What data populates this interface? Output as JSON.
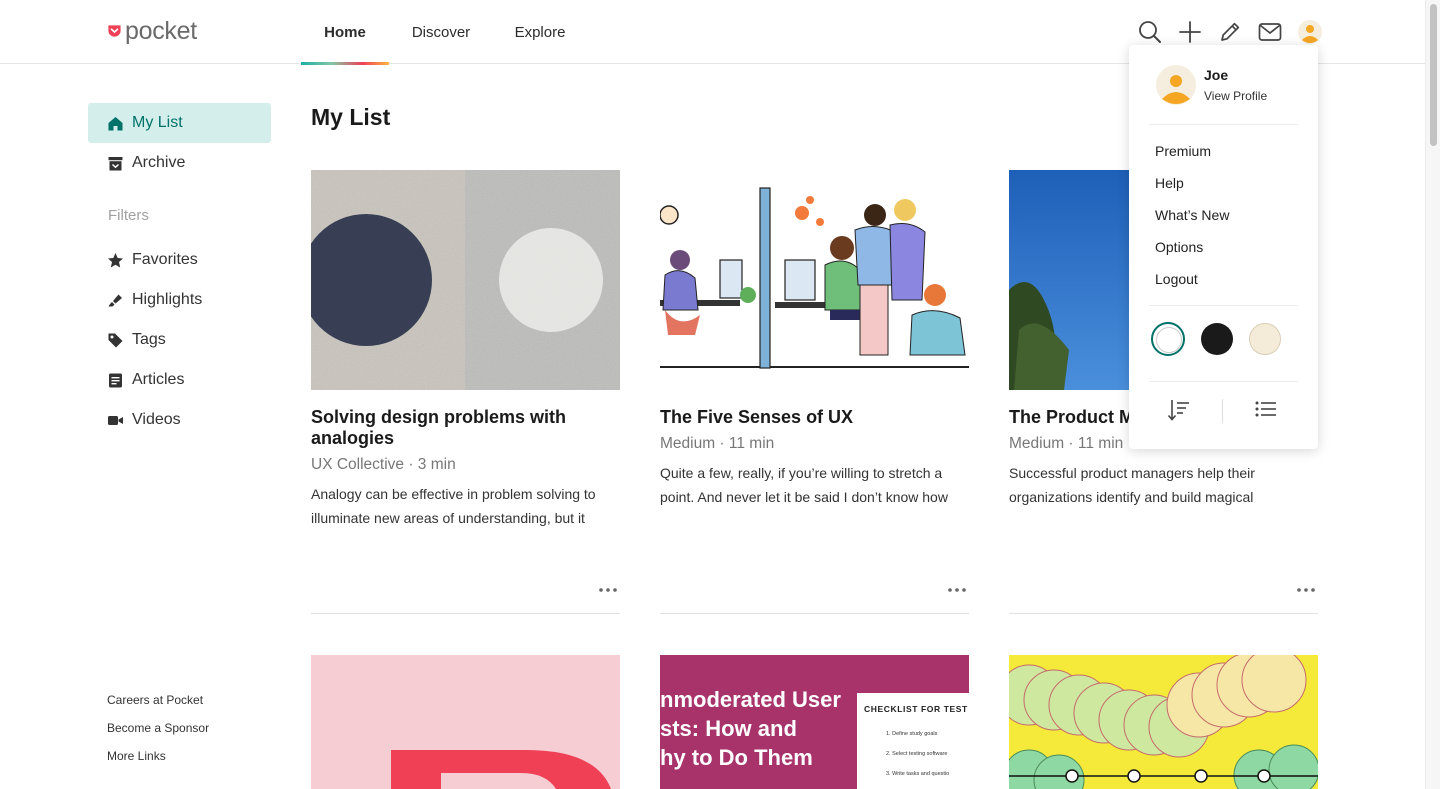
{
  "app": {
    "logo_text": "pocket",
    "brand_color": "#ef4056",
    "accent_color": "#00726a"
  },
  "nav": {
    "tabs": [
      {
        "label": "Home"
      },
      {
        "label": "Discover"
      },
      {
        "label": "Explore"
      }
    ]
  },
  "header_icons": [
    "search-icon",
    "add-icon",
    "pencil-icon",
    "mail-icon",
    "avatar-icon"
  ],
  "sidebar": {
    "items": [
      {
        "label": "My List",
        "icon": "home-icon"
      },
      {
        "label": "Archive",
        "icon": "archive-icon"
      }
    ],
    "filters_label": "Filters",
    "filters": [
      {
        "label": "Favorites",
        "icon": "star-icon"
      },
      {
        "label": "Highlights",
        "icon": "highlighter-icon"
      },
      {
        "label": "Tags",
        "icon": "tag-icon"
      },
      {
        "label": "Articles",
        "icon": "article-icon"
      },
      {
        "label": "Videos",
        "icon": "video-icon"
      }
    ],
    "footer_links": [
      "Careers at Pocket",
      "Become a Sponsor",
      "More Links"
    ]
  },
  "main": {
    "title": "My List",
    "cards": [
      {
        "title": "Solving design problems with analogies",
        "meta": "UX Collective · 3 min",
        "excerpt": "Analogy can be effective in problem solving to illuminate new areas of understanding, but it"
      },
      {
        "title": "The Five Senses of UX",
        "meta": "Medium · 11 min",
        "excerpt": "Quite a few, really, if you’re willing to stretch a point. And never let it be said I don’t know how"
      },
      {
        "title": "The Product M User Science",
        "meta": "Medium · 11 min",
        "excerpt": "Successful product managers help their organizations identify and build magical"
      }
    ],
    "second_row": {
      "card2_lines": [
        "nmoderated User",
        "sts: How and",
        "hy to Do Them"
      ],
      "card2_checklist_title": "CHECKLIST FOR TEST",
      "card2_checklist_items": [
        "1. Define study goals",
        "2. Select testing software",
        "3. Write tasks and questio"
      ]
    }
  },
  "profile_menu": {
    "name": "Joe",
    "view_profile": "View Profile",
    "items": [
      "Premium",
      "Help",
      "What’s New",
      "Options",
      "Logout"
    ],
    "themes": [
      "light",
      "dark",
      "sepia"
    ],
    "bottom_icons": [
      "sort-icon",
      "list-view-icon"
    ]
  }
}
